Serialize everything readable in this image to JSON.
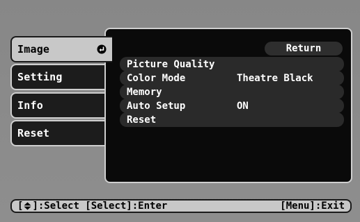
{
  "tabs": [
    {
      "label": "Image",
      "active": true
    },
    {
      "label": "Setting",
      "active": false
    },
    {
      "label": "Info",
      "active": false
    },
    {
      "label": "Reset",
      "active": false
    }
  ],
  "panel": {
    "return_label": "Return",
    "items": [
      {
        "label": "Picture Quality",
        "value": ""
      },
      {
        "label": "Color Mode",
        "value": "Theatre Black"
      },
      {
        "label": "Memory",
        "value": ""
      },
      {
        "label": "Auto Setup",
        "value": "ON"
      },
      {
        "label": "Reset",
        "value": ""
      }
    ]
  },
  "footer": {
    "bracket_open": "[",
    "select_hint": "]:Select [Select]:Enter",
    "exit_hint": "[Menu]:Exit"
  },
  "icons": {
    "enter": "enter-icon",
    "updown": "up-down-arrow-icon"
  },
  "colors": {
    "background": "#8a8a8a",
    "panel": "#0a0a0a",
    "active_tab": "#c8c8c8",
    "inactive_tab": "#1c1c1c",
    "item_bar": "#2a2a2a"
  }
}
